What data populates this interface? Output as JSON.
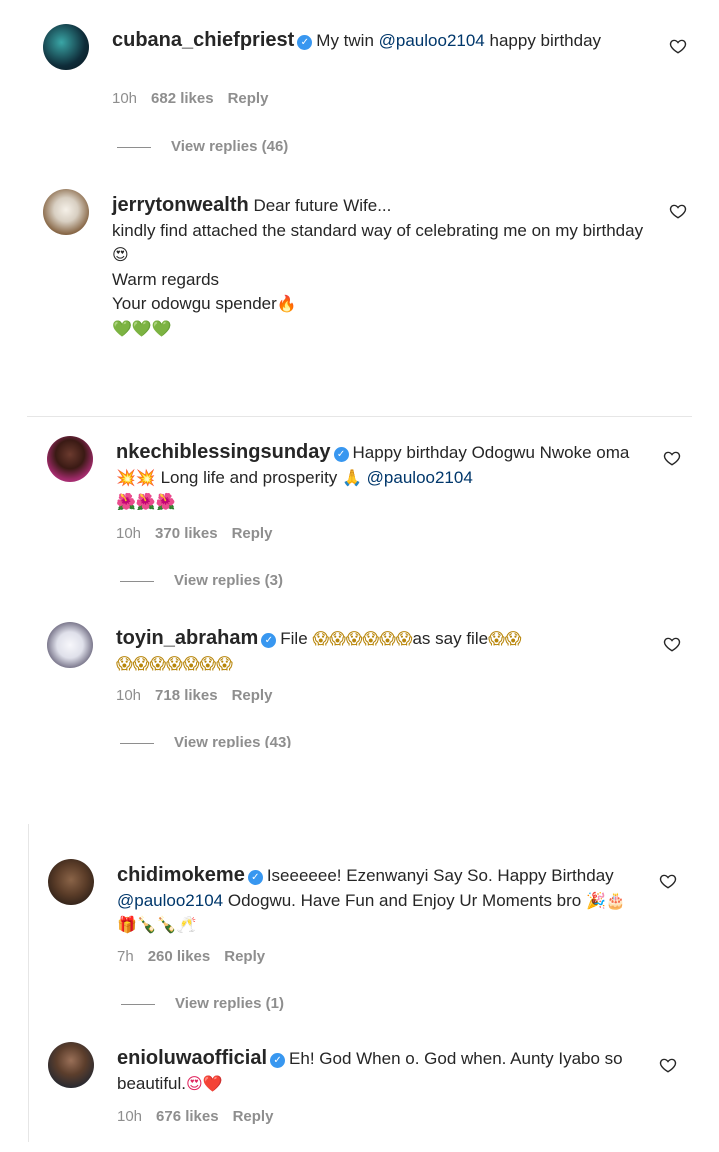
{
  "comments": [
    {
      "username": "cubana_chiefpriest",
      "verified": true,
      "text_before": "My twin ",
      "mention": "@pauloo2104",
      "text_after": " happy birthday",
      "time": "10h",
      "likes": "682 likes",
      "reply": "Reply",
      "view_replies": "View replies (46)"
    },
    {
      "username": "jerrytonwealth",
      "verified": false,
      "line1": "Dear future Wife...",
      "line2": "kindly find attached the standard way of celebrating me on my birthday",
      "line2_emoji": "😍",
      "line3": "Warm regards",
      "line4": "Your odowgu spender",
      "line4_emoji": "🔥",
      "line5_emoji": "💚💚💚"
    },
    {
      "username": "nkechiblessingsunday",
      "verified": true,
      "text_a": "Happy birthday Odogwu Nwoke oma",
      "emoji_a": "💥💥",
      "text_b": " Long life and prosperity ",
      "emoji_b": "🙏",
      "mention": "@pauloo2104",
      "emoji_c": "🌺🌺🌺",
      "time": "10h",
      "likes": "370 likes",
      "reply": "Reply",
      "view_replies": "View replies (3)"
    },
    {
      "username": "toyin_abraham",
      "verified": true,
      "text_a": "File ",
      "emoji_a": "😱😱😱😱😱😱",
      "text_b": "as say file",
      "emoji_b": "😱😱",
      "emoji_c": "😱😱😱😱😱😱😱",
      "time": "10h",
      "likes": "718 likes",
      "reply": "Reply",
      "view_replies": "View replies (43)"
    },
    {
      "username": "chidimokeme",
      "verified": true,
      "text_a": "Iseeeeee! Ezenwanyi Say So. Happy Birthday ",
      "mention": "@pauloo2104",
      "text_b": " Odogwu. Have Fun and Enjoy Ur Moments bro ",
      "emoji_a": "🎉🎂🎁🍾🍾🥂",
      "time": "7h",
      "likes": "260 likes",
      "reply": "Reply",
      "view_replies": "View replies (1)"
    },
    {
      "username": "enioluwaofficial",
      "verified": true,
      "text_a": "Eh! God When o. God when. Aunty Iyabo so beautiful.",
      "emoji_a": "😍❤️",
      "time": "10h",
      "likes": "676 likes",
      "reply": "Reply"
    }
  ],
  "colors": {
    "verified": "#3897f0",
    "mention": "#00376b",
    "meta": "#8e8e8e"
  },
  "icons": {
    "like": "heart-outline-icon",
    "verified": "verified-badge-icon"
  }
}
